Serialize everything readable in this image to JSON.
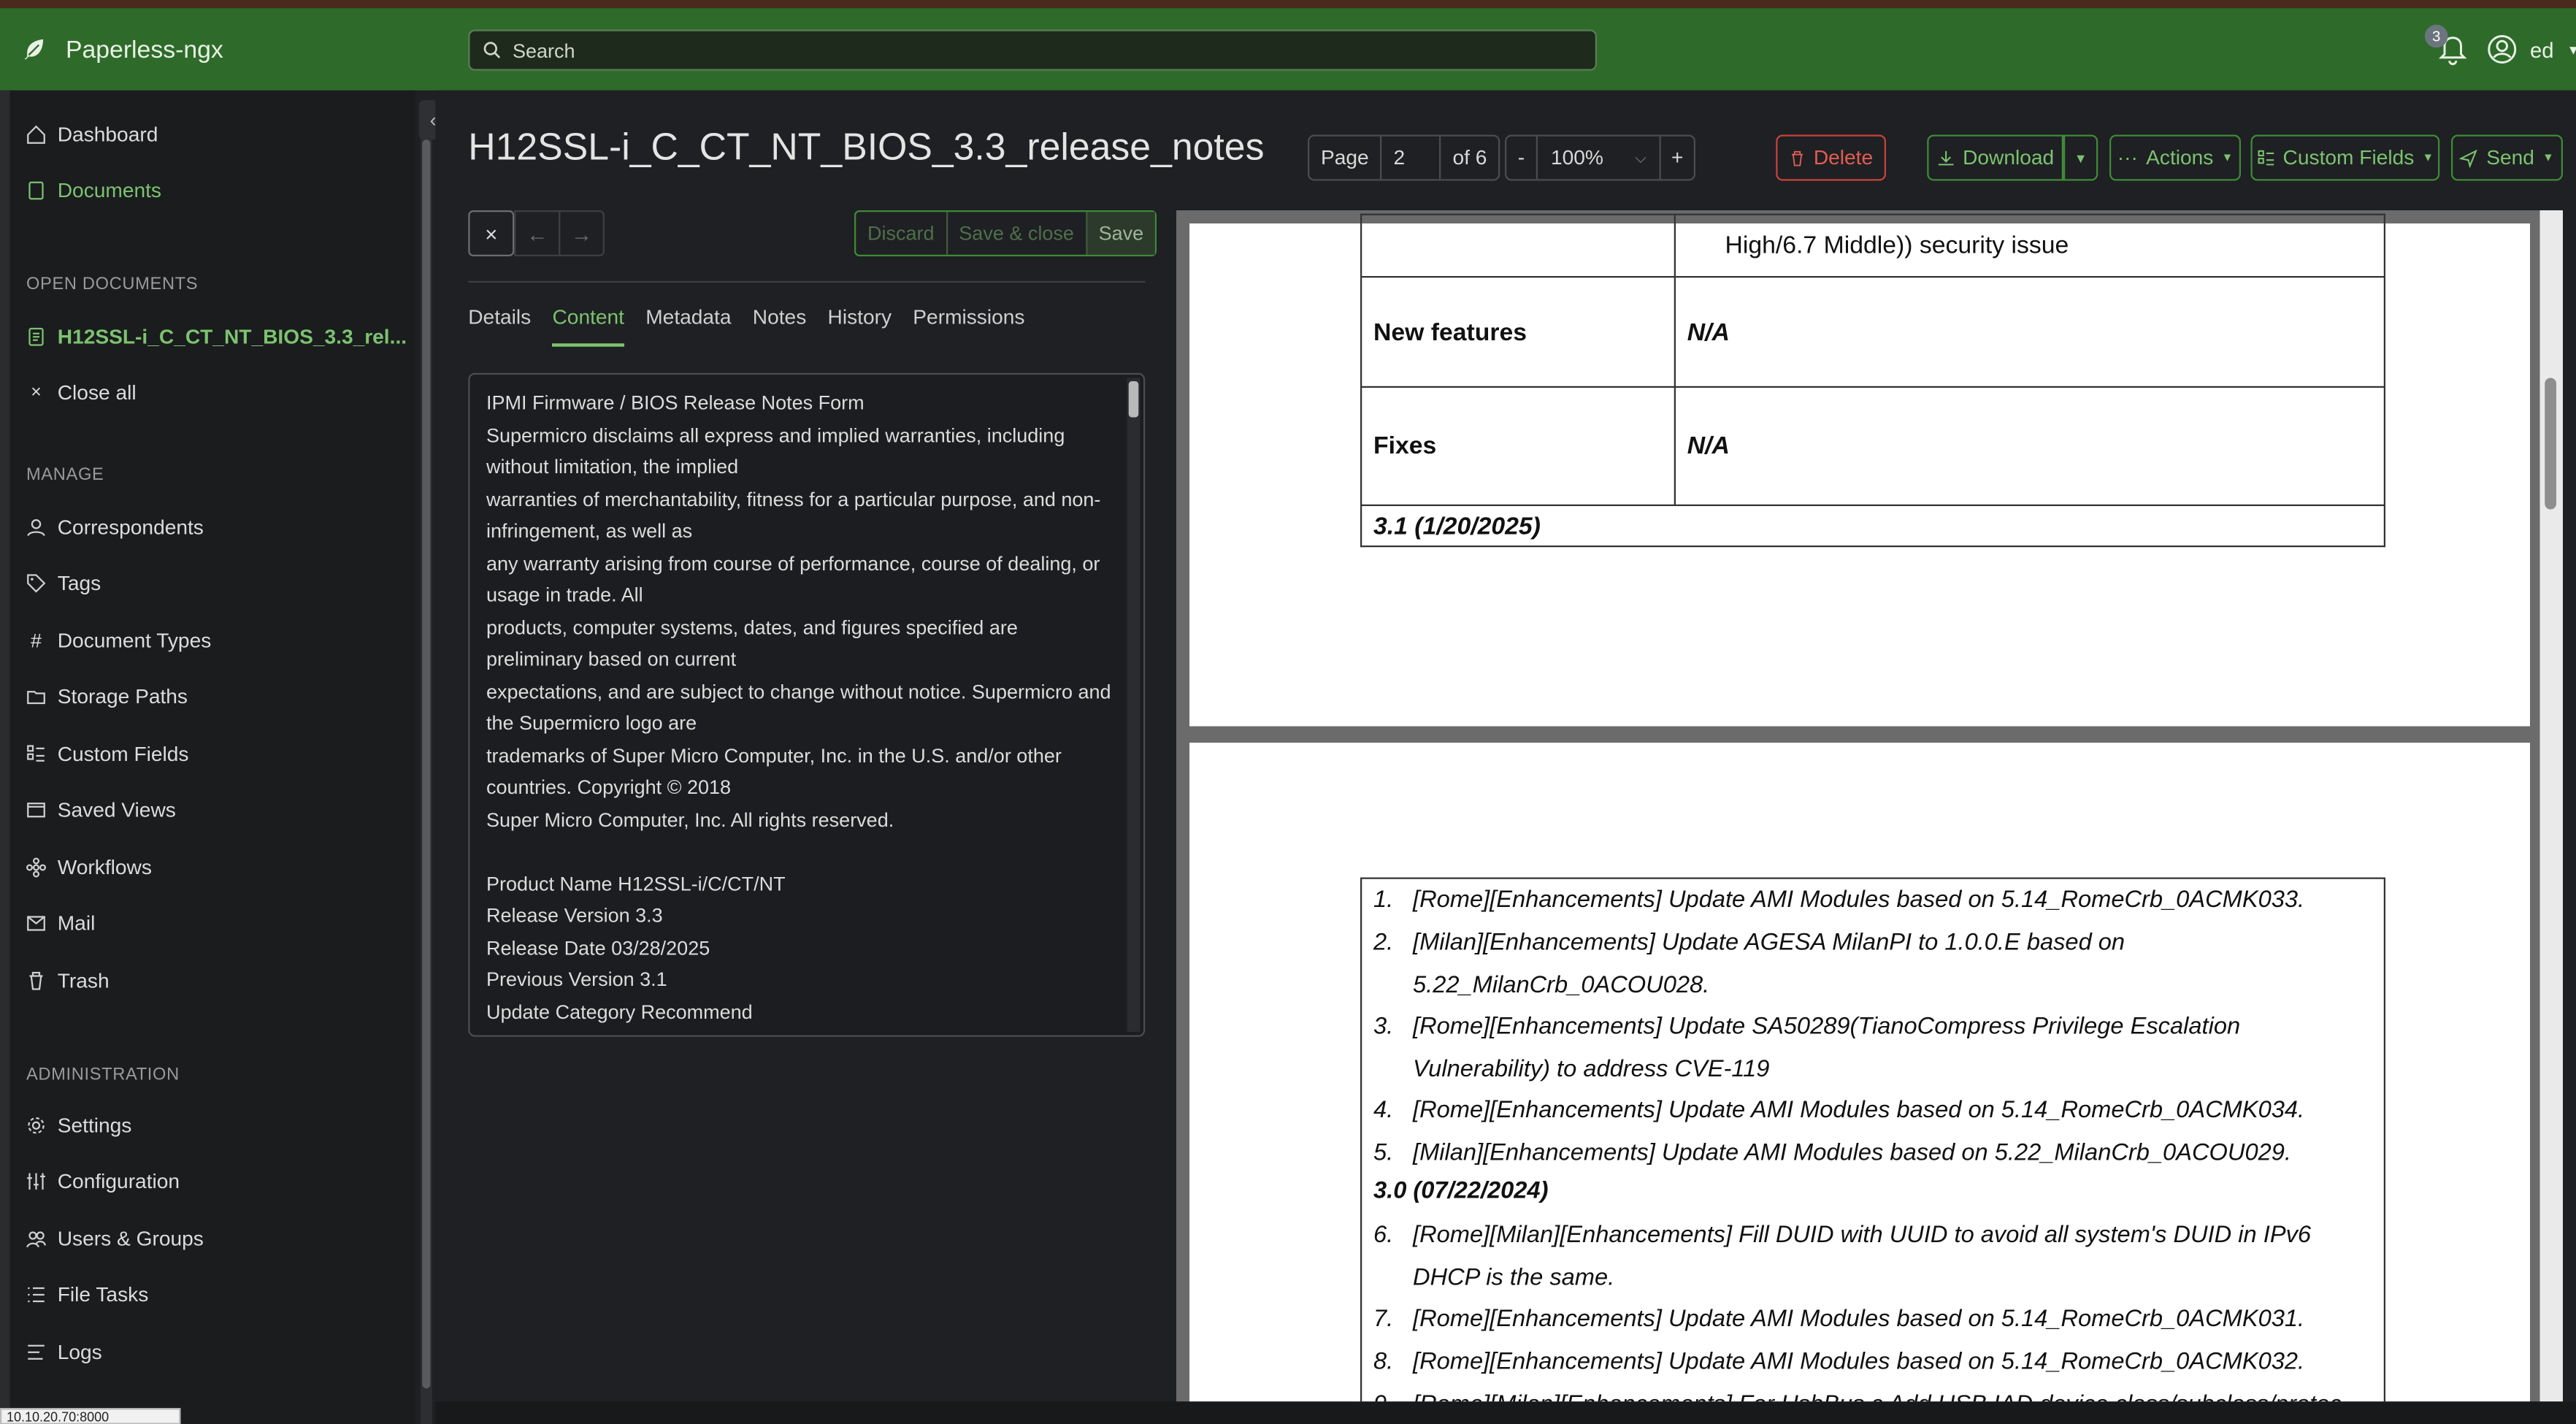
{
  "app": {
    "name": "Paperless-ngx"
  },
  "search": {
    "placeholder": "Search"
  },
  "notifications": {
    "count": "3"
  },
  "user": {
    "name": "ed"
  },
  "sidebar": {
    "items": [
      {
        "label": "Dashboard"
      },
      {
        "label": "Documents"
      }
    ],
    "open_documents_heading": "OPEN DOCUMENTS",
    "open_document": "H12SSL-i_C_CT_NT_BIOS_3.3_rel...",
    "close_all": "Close all",
    "manage_heading": "MANAGE",
    "manage": [
      {
        "label": "Correspondents"
      },
      {
        "label": "Tags"
      },
      {
        "label": "Document Types"
      },
      {
        "label": "Storage Paths"
      },
      {
        "label": "Custom Fields"
      },
      {
        "label": "Saved Views"
      },
      {
        "label": "Workflows"
      },
      {
        "label": "Mail"
      },
      {
        "label": "Trash"
      }
    ],
    "admin_heading": "ADMINISTRATION",
    "admin": [
      {
        "label": "Settings"
      },
      {
        "label": "Configuration"
      },
      {
        "label": "Users & Groups"
      },
      {
        "label": "File Tasks"
      },
      {
        "label": "Logs"
      }
    ],
    "status_url": "10.10.20.70:8000",
    "partial_item": "on"
  },
  "document": {
    "title": "H12SSL-i_C_CT_NT_BIOS_3.3_release_notes",
    "page_label": "Page",
    "page_current": "2",
    "page_total": "of 6",
    "zoom_minus": "-",
    "zoom_value": "100%",
    "zoom_plus": "+"
  },
  "actions": {
    "delete": "Delete",
    "download": "Download",
    "actions": "Actions",
    "custom_fields": "Custom Fields",
    "send": "Send"
  },
  "editor": {
    "close": "×",
    "prev": "←",
    "next": "→",
    "discard": "Discard",
    "save_close": "Save & close",
    "save": "Save"
  },
  "tabs": [
    "Details",
    "Content",
    "Metadata",
    "Notes",
    "History",
    "Permissions"
  ],
  "content_lines": [
    "IPMI Firmware / BIOS Release Notes Form",
    "Supermicro disclaims all express and implied warranties, including without limitation, the implied",
    "warranties of merchantability, fitness for a particular purpose, and non-infringement, as well as",
    "any warranty arising from course of performance, course of dealing, or usage in trade. All",
    "products, computer systems, dates, and figures specified are preliminary based on current",
    "expectations, and are subject to change without notice. Supermicro and the Supermicro logo are",
    "trademarks of Super Micro Computer, Inc. in the U.S. and/or other countries. Copyright © 2018",
    "Super Micro Computer, Inc. All rights reserved.",
    "",
    "Product Name H12SSL-i/C/CT/NT",
    "Release Version 3.3",
    "Release Date 03/28/2025",
    "Previous Version 3.1",
    "Update Category Recommend"
  ],
  "pdf": {
    "page1": {
      "top_cell": "High/6.7 Middle)) security issue",
      "rows": [
        {
          "label": "New features",
          "value": "N/A"
        },
        {
          "label": "Fixes",
          "value": "N/A"
        }
      ],
      "version_row": "3.1 (1/20/2025)"
    },
    "page2": {
      "items_a": [
        {
          "n": "1.",
          "text": "[Rome][Enhancements] Update AMI Modules based on 5.14_RomeCrb_0ACMK033."
        },
        {
          "n": "2.",
          "text": "[Milan][Enhancements] Update AGESA MilanPI to 1.0.0.E based on 5.22_MilanCrb_0ACOU028."
        },
        {
          "n": "3.",
          "text": "[Rome][Enhancements] Update SA50289(TianoCompress Privilege Escalation Vulnerability) to address CVE-119"
        },
        {
          "n": "4.",
          "text": "[Rome][Enhancements] Update AMI Modules based on 5.14_RomeCrb_0ACMK034."
        },
        {
          "n": "5.",
          "text": "[Milan][Enhancements] Update AMI Modules based on 5.22_MilanCrb_0ACOU029."
        }
      ],
      "subheading": "3.0 (07/22/2024)",
      "items_b": [
        {
          "n": "6.",
          "text": "[Rome][Milan][Enhancements] Fill DUID with UUID to avoid all system's DUID in IPv6 DHCP is the same."
        },
        {
          "n": "7.",
          "text": "[Rome][Enhancements] Update AMI Modules based on 5.14_RomeCrb_0ACMK031."
        },
        {
          "n": "8.",
          "text": "[Rome][Enhancements] Update AMI Modules based on 5.14_RomeCrb_0ACMK032."
        },
        {
          "n": "9.",
          "text": "[Rome][Milan][Enhancements] For UsbBus c Add USB IAD device class/subclass/protocol"
        }
      ]
    }
  },
  "colors": {
    "navbar": "#2e6b2a",
    "accent": "#7cc36f",
    "danger": "#e35c52",
    "sidebar": "#1a1c1e"
  }
}
